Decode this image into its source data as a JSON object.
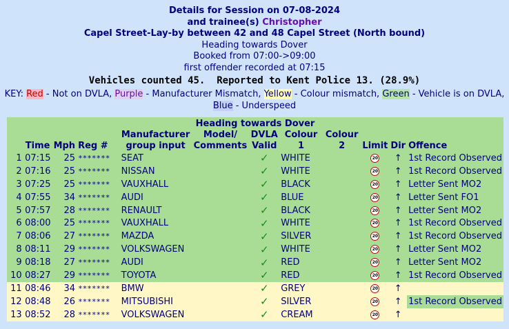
{
  "header": {
    "title": "Details for Session on 07-08-2024",
    "trainee_prefix": "and trainee(s)",
    "trainee_name": "Christopher",
    "location": "Capel Street-Lay-by between 42 and 48 Capel Street (North bound)",
    "heading": "Heading towards Dover",
    "booked": "Booked from 07:00->09:00",
    "first_offender": "first offender recorded at 07:15",
    "counts": "Vehicles counted 45.  Reported to Kent Police 13. (28.9%)"
  },
  "key": {
    "prefix": "KEY:",
    "red": "Red",
    "red_desc": " - Not on DVLA, ",
    "purple": "Purple",
    "purple_desc": " - Manufacturer Mismatch, ",
    "yellow": "Yellow",
    "yellow_desc": " - Colour mismatch, ",
    "green": "Green",
    "green_desc": " - Vehicle is on DVLA,",
    "blue": "Blue",
    "blue_desc": " - Underspeed"
  },
  "table": {
    "caption": "Heading towards Dover",
    "columns": {
      "time": "Time",
      "mph": "Mph",
      "reg": "Reg #",
      "manufacturer": "Manufacturer group input",
      "model": "Model/ Comments",
      "dvla": "DVLA Valid",
      "colour1": "Colour 1",
      "colour2": "Colour 2",
      "limit": "Limit",
      "dir": "Dir",
      "offence": "Offence"
    },
    "limit_value": "20",
    "rows": [
      {
        "n": "1",
        "time": "07:15",
        "mph": "25",
        "reg": "*******",
        "make": "SEAT",
        "colour": "WHITE",
        "dir": "↑",
        "offence": "1st Record Observed"
      },
      {
        "n": "2",
        "time": "07:16",
        "mph": "25",
        "reg": "*******",
        "make": "NISSAN",
        "colour": "WHITE",
        "dir": "↑",
        "offence": "1st Record Observed"
      },
      {
        "n": "3",
        "time": "07:25",
        "mph": "25",
        "reg": "*******",
        "make": "VAUXHALL",
        "colour": "BLACK",
        "dir": "↑",
        "offence": "Letter Sent MO2"
      },
      {
        "n": "4",
        "time": "07:55",
        "mph": "34",
        "reg": "*******",
        "make": "AUDI",
        "colour": "BLUE",
        "dir": "↑",
        "offence": "Letter Sent FO1"
      },
      {
        "n": "5",
        "time": "07:57",
        "mph": "28",
        "reg": "*******",
        "make": "RENAULT",
        "colour": "BLACK",
        "dir": "↑",
        "offence": "Letter Sent MO2"
      },
      {
        "n": "6",
        "time": "08:00",
        "mph": "25",
        "reg": "*******",
        "make": "VAUXHALL",
        "colour": "WHITE",
        "dir": "↑",
        "offence": "1st Record Observed"
      },
      {
        "n": "7",
        "time": "08:06",
        "mph": "27",
        "reg": "*******",
        "make": "MAZDA",
        "colour": "SILVER",
        "dir": "↑",
        "offence": "1st Record Observed"
      },
      {
        "n": "8",
        "time": "08:11",
        "mph": "29",
        "reg": "*******",
        "make": "VOLKSWAGEN",
        "colour": "WHITE",
        "dir": "↑",
        "offence": "Letter Sent MO2"
      },
      {
        "n": "9",
        "time": "08:18",
        "mph": "27",
        "reg": "*******",
        "make": "AUDI",
        "colour": "RED",
        "dir": "↑",
        "offence": "Letter Sent MO2"
      },
      {
        "n": "10",
        "time": "08:27",
        "mph": "29",
        "reg": "*******",
        "make": "TOYOTA",
        "colour": "RED",
        "dir": "↑",
        "offence": "1st Record Observed"
      },
      {
        "n": "11",
        "time": "08:46",
        "mph": "34",
        "reg": "*******",
        "make": "BMW",
        "colour": "GREY",
        "dir": "↑",
        "offence": ""
      },
      {
        "n": "12",
        "time": "08:48",
        "mph": "26",
        "reg": "*******",
        "make": "MITSUBISHI",
        "colour": "SILVER",
        "dir": "↑",
        "offence": "1st Record Observed"
      },
      {
        "n": "13",
        "time": "08:52",
        "mph": "28",
        "reg": "*******",
        "make": "VOLKSWAGEN",
        "colour": "CREAM",
        "dir": "↑",
        "offence": ""
      }
    ]
  },
  "colors": {
    "page_bg": "#cfe3fa",
    "row_green": "#a9dd96",
    "row_yellow": "#fff8c6",
    "text": "#000080"
  }
}
